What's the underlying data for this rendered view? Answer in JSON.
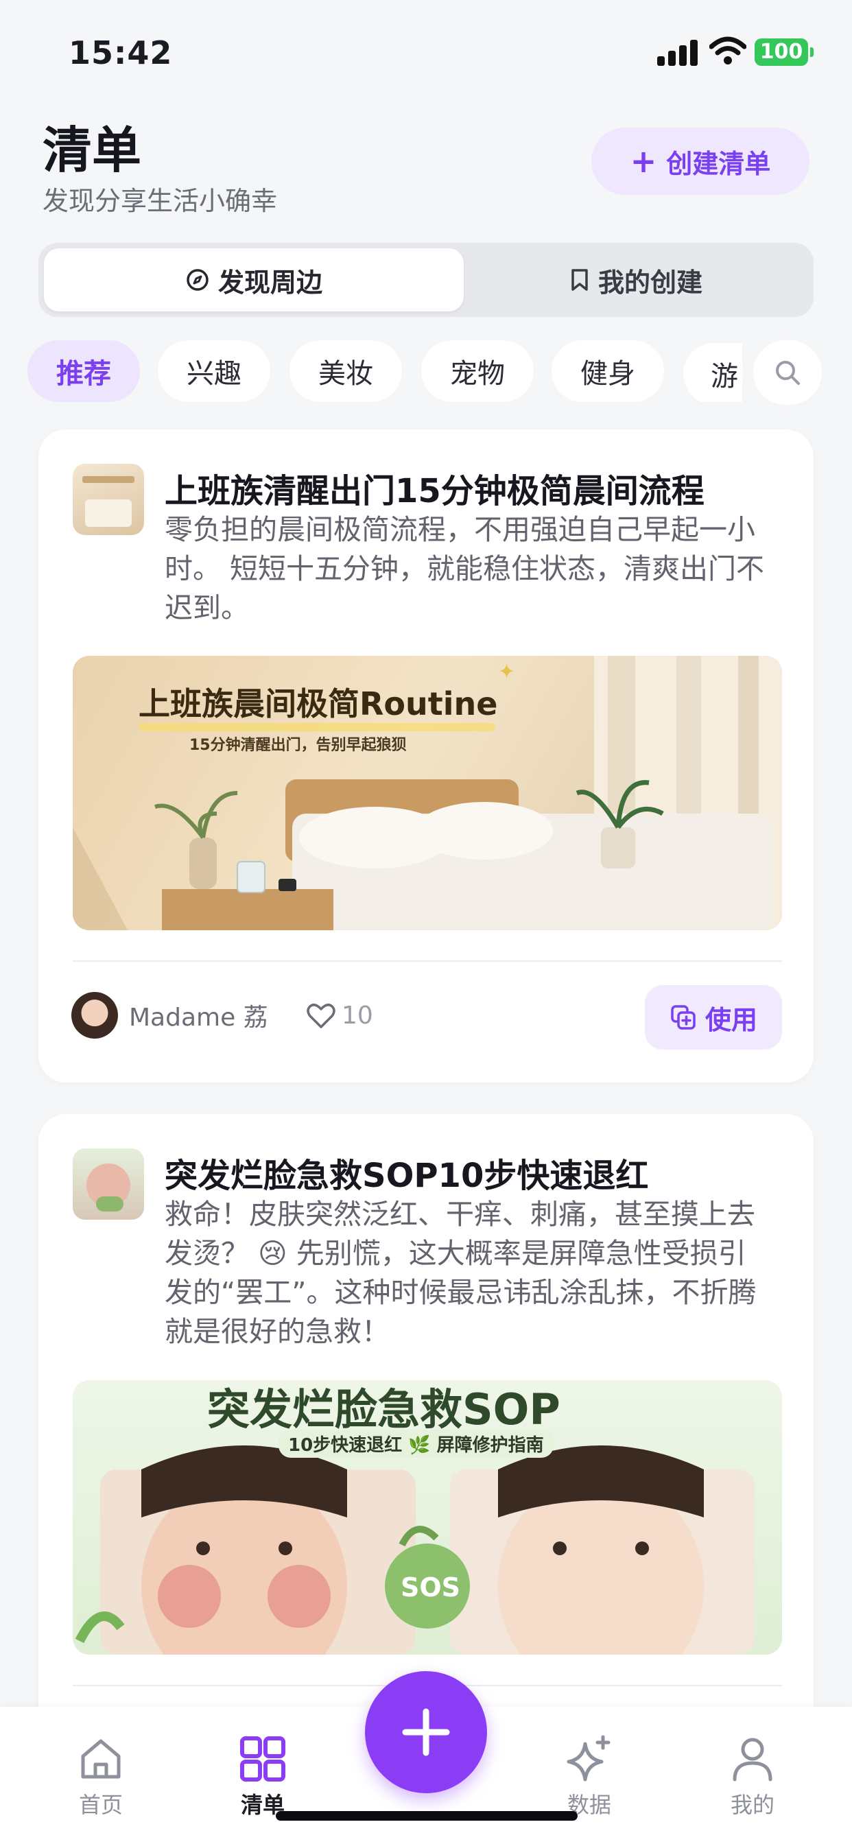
{
  "status_bar": {
    "time": "15:42",
    "battery": "100"
  },
  "header": {
    "title": "清单",
    "subtitle": "发现分享生活小确幸",
    "create_button": "创建清单"
  },
  "segmented": {
    "tabs": [
      {
        "label": "发现周边",
        "active": true,
        "icon": "compass-icon"
      },
      {
        "label": "我的创建",
        "active": false,
        "icon": "bookmark-icon"
      }
    ]
  },
  "categories": {
    "items": [
      "推荐",
      "兴趣",
      "美妆",
      "宠物",
      "健身",
      "游"
    ],
    "active_index": 0
  },
  "cards": [
    {
      "title": "上班族清醒出门15分钟极简晨间流程",
      "description": "零负担的晨间极简流程，不用强迫自己早起一小时。 短短十五分钟，就能稳住状态，清爽出门不迟到。",
      "image_title": "上班族晨间极简Routine",
      "image_subtitle": "15分钟清醒出门，告别早起狼狈",
      "author": "Madame 荔",
      "likes": "10",
      "action": "使用"
    },
    {
      "title": "突发烂脸急救SOP10步快速退红",
      "description": "救命！皮肤突然泛红、干痒、刺痛，甚至摸上去发烫？ 😢 先别慌，这大概率是屏障急性受损引发的“罢工”。这种时候最忌讳乱涂乱抹，不折腾就是很好的急救！",
      "image_title": "突发烂脸急救SOP",
      "image_subtitle": "10步快速退红 🌿 屏障修护指南",
      "image_badge": "SOS"
    }
  ],
  "tab_bar": {
    "items": [
      {
        "label": "首页",
        "icon": "home-icon"
      },
      {
        "label": "清单",
        "icon": "grid-icon",
        "active": true
      },
      {
        "label": "数据",
        "icon": "sparkle-icon"
      },
      {
        "label": "我的",
        "icon": "user-icon"
      }
    ]
  },
  "colors": {
    "accent": "#8b3df5",
    "accent_light": "#efe7fd",
    "battery": "#34c759",
    "background": "#f5f6f8"
  }
}
